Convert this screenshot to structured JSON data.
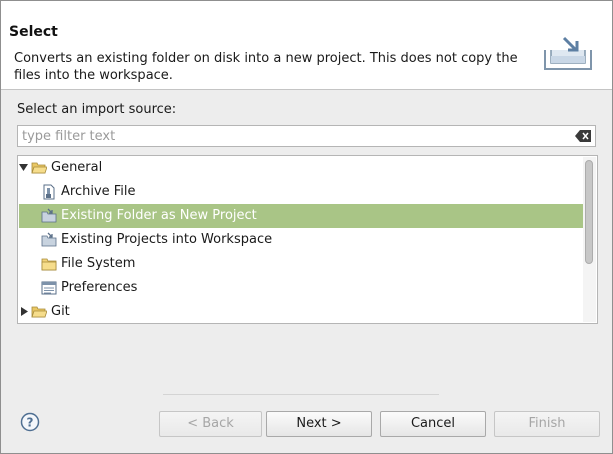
{
  "header": {
    "title": "Select",
    "description": "Converts an existing folder on disk into a new project. This does not copy the files into the workspace.",
    "icon": "import-wizard-icon"
  },
  "import_source": {
    "label": "Select an import source:",
    "filter_placeholder": "type filter text",
    "filter_value": "",
    "clear_icon": "clear-filter-icon"
  },
  "tree": {
    "items": [
      {
        "label": "General",
        "icon": "folder-open-icon",
        "expanded": true,
        "depth": 0
      },
      {
        "label": "Archive File",
        "icon": "archive-file-icon",
        "depth": 1
      },
      {
        "label": "Existing Folder as New Project",
        "icon": "project-import-icon",
        "depth": 1,
        "selected": true
      },
      {
        "label": "Existing Projects into Workspace",
        "icon": "project-import-icon",
        "depth": 1
      },
      {
        "label": "File System",
        "icon": "folder-icon",
        "depth": 1
      },
      {
        "label": "Preferences",
        "icon": "preferences-icon",
        "depth": 1
      },
      {
        "label": "Git",
        "icon": "folder-open-icon",
        "expanded": false,
        "depth": 0
      }
    ]
  },
  "buttons": {
    "help_icon": "help-icon",
    "back": "< Back",
    "next": "Next >",
    "cancel": "Cancel",
    "finish": "Finish"
  },
  "colors": {
    "selection": "#a9c586",
    "dialog_background": "#ededed",
    "header_background": "#ffffff"
  }
}
